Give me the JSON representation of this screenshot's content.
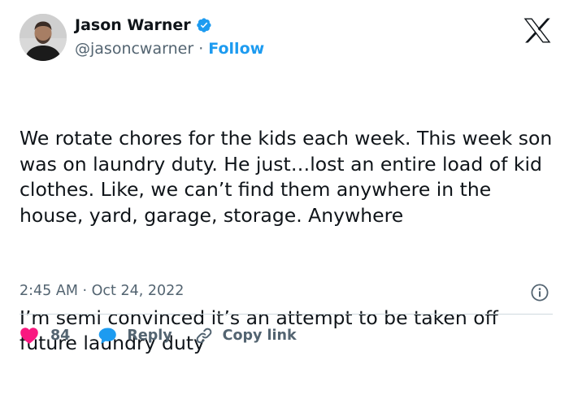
{
  "author": {
    "name": "Jason Warner",
    "handle": "@jasoncwarner",
    "separator": "·",
    "follow_label": "Follow",
    "verified_icon": "verified-badge-icon",
    "avatar_icon": "avatar"
  },
  "platform_logo": "x-logo-icon",
  "tweet": {
    "paragraphs": [
      "We rotate chores for the kids each week. This week son was on laundry duty. He just…lost an entire load of kid clothes. Like, we can’t find them anywhere in the house, yard, garage, storage. Anywhere",
      "I’m semi convinced it’s an attempt to be taken off future laundry duty"
    ]
  },
  "timestamp": "2:45 AM · Oct 24, 2022",
  "info_icon": "info-icon",
  "actions": {
    "like_count": "84",
    "reply_label": "Reply",
    "copy_link_label": "Copy link"
  },
  "colors": {
    "accent": "#1d9bf0",
    "like": "#f91880",
    "text": "#0f1419",
    "muted": "#536471",
    "divider": "#cfd9de"
  }
}
